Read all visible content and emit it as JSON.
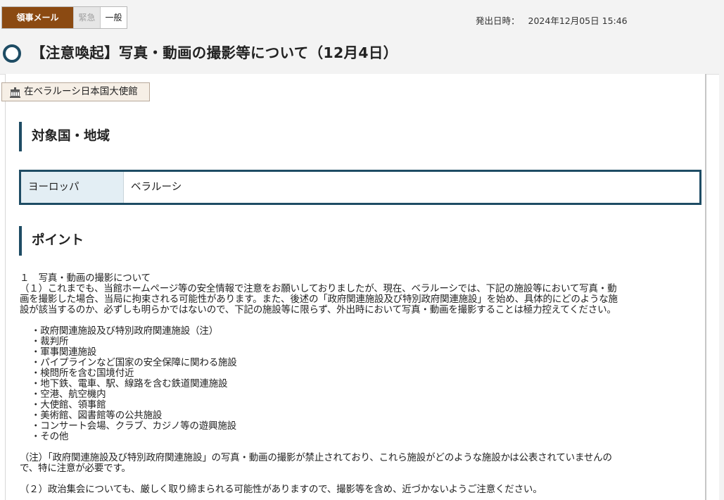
{
  "header": {
    "category_main": "領事メール",
    "category_urgent": "緊急",
    "category_general": "一般",
    "issue_label": "発出日時：",
    "issue_datetime": "2024年12月05日 15:46",
    "title": "【注意喚起】写真・動画の撮影等について（12月4日）"
  },
  "sender": {
    "icon": "building-icon",
    "name": "在ベラルーシ日本国大使館"
  },
  "region_section": {
    "heading": "対象国・地域",
    "label": "ヨーロッパ",
    "value": "ベラルーシ"
  },
  "points_section": {
    "heading": "ポイント",
    "item1_title": "１　写真・動画の撮影について",
    "item1_para1_line1": "（１）これまでも、当館ホームページ等の安全情報で注意をお願いしておりましたが、現在、ベラルーシでは、下記の施設等において写真・動",
    "item1_para1_line2": "画を撮影した場合、当局に拘束される可能性があります。また、後述の「政府関連施設及び特別政府関連施設」を始め、具体的にどのような施",
    "item1_para1_line3": "設が該当するのか、必ずしも明らかではないので、下記の施設等に限らず、外出時において写真・動画を撮影することは極力控えてください。",
    "facilities": [
      "・政府関連施設及び特別政府関連施設（注）",
      "・裁判所",
      "・軍事関連施設",
      "・パイプラインなど国家の安全保障に関わる施設",
      "・検問所を含む国境付近",
      "・地下鉄、電車、駅、線路を含む鉄道関連施設",
      "・空港、航空機内",
      "・大使館、領事館",
      "・美術館、図書館等の公共施設",
      "・コンサート会場、クラブ、カジノ等の遊興施設",
      "・その他"
    ],
    "note_line1": "（注）「政府関連施設及び特別政府関連施設」の写真・動画の撮影が禁止されており、これら施設がどのような施設かは公表されていませんの",
    "note_line2": "で、特に注意が必要です。",
    "item1_para2": "（２）政治集会についても、厳しく取り締まられる可能性がありますので、撮影等を含め、近づかないようご注意ください。"
  },
  "colors": {
    "brand_brown": "#8b4a12",
    "accent_navy": "#1e4c64",
    "label_bg": "#e3eef4"
  }
}
